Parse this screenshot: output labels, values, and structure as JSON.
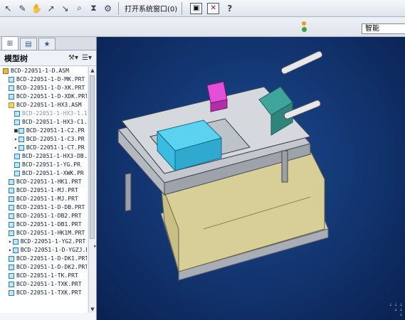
{
  "toolbar": {
    "icons": [
      "arrow-select-icon",
      "edit-tool-icon",
      "hand-icon",
      "pointer-icon",
      "pointer-alt-icon",
      "search-icon",
      "query-icon",
      "settings-icon"
    ],
    "open_window_label": "打开系统窗口(0)",
    "right_icons": [
      "window-icon",
      "close-window-icon",
      "help-icon"
    ]
  },
  "filter": {
    "value": "智能"
  },
  "panel": {
    "tabs": [
      "model-tree-tab",
      "folder-tab",
      "favorites-tab"
    ],
    "title": "模型树",
    "tree": [
      {
        "label": "BCD-22051-1-D.ASM",
        "level": 0,
        "kind": "asm-root"
      },
      {
        "label": "BCD-22051-1-D-MK.PRT",
        "level": 1,
        "kind": "prt"
      },
      {
        "label": "BCD-22051-1-D-XK.PRT",
        "level": 1,
        "kind": "prt"
      },
      {
        "label": "BCD-22051-1-D-XDK.PRT",
        "level": 1,
        "kind": "prt"
      },
      {
        "label": "BCD-22051-1-HX3.ASM",
        "level": 1,
        "kind": "asm"
      },
      {
        "label": "BCD-22051-1-HX3-1.1",
        "level": 2,
        "kind": "prt",
        "dim": true
      },
      {
        "label": "BCD-22051-1-HX3-C1.",
        "level": 2,
        "kind": "prt"
      },
      {
        "label": "BCD-22051-1-C2.PR",
        "level": 2,
        "kind": "prt",
        "mark": "■"
      },
      {
        "label": "BCD-22051-1-C3.PR",
        "level": 2,
        "kind": "prt",
        "mark": "▸"
      },
      {
        "label": "BCD-22051-1-CT.PR",
        "level": 2,
        "kind": "prt",
        "mark": "▸"
      },
      {
        "label": "BCD-22051-1-HX3-DB.",
        "level": 2,
        "kind": "prt"
      },
      {
        "label": "BCD-22051-1-YG.PR",
        "level": 2,
        "kind": "prt"
      },
      {
        "label": "BCD-22051-1-XWK.PR",
        "level": 2,
        "kind": "prt"
      },
      {
        "label": "BCD-22051-1-HK1.PRT",
        "level": 1,
        "kind": "prt"
      },
      {
        "label": "BCD-22051-1-MJ.PRT",
        "level": 1,
        "kind": "prt"
      },
      {
        "label": "BCD-22051-1-MJ.PRT",
        "level": 1,
        "kind": "prt"
      },
      {
        "label": "BCD-22051-1-D-DB.PRT",
        "level": 1,
        "kind": "prt"
      },
      {
        "label": "BCD-22051-1-DB2.PRT",
        "level": 1,
        "kind": "prt"
      },
      {
        "label": "BCD-22051-1-DB1.PRT",
        "level": 1,
        "kind": "prt"
      },
      {
        "label": "BCD-22051-1-HK1M.PRT",
        "level": 1,
        "kind": "prt"
      },
      {
        "label": "BCD-22051-1-YG2.PRT",
        "level": 1,
        "kind": "prt",
        "mark": "▸"
      },
      {
        "label": "BCD-22051-1-D-YGZJ.P",
        "level": 1,
        "kind": "prt",
        "mark": "▸"
      },
      {
        "label": "BCD-22051-1-D-DK1.PRT",
        "level": 1,
        "kind": "prt"
      },
      {
        "label": "BCD-22051-1-D-DK2.PRT",
        "level": 1,
        "kind": "prt"
      },
      {
        "label": "BCD-22051-1-TK.PRT",
        "level": 1,
        "kind": "prt"
      },
      {
        "label": "BCD-22051-1-TXK.PRT",
        "level": 1,
        "kind": "prt"
      },
      {
        "label": "BCD-22051-1-TXK.PRT",
        "level": 1,
        "kind": "prt"
      }
    ]
  },
  "viewport": {
    "colors": {
      "cyan_part": "#2fc3e8",
      "magenta_part": "#d93fc9",
      "teal_part": "#3fa49a",
      "yellow_part": "#d8cf98"
    }
  }
}
